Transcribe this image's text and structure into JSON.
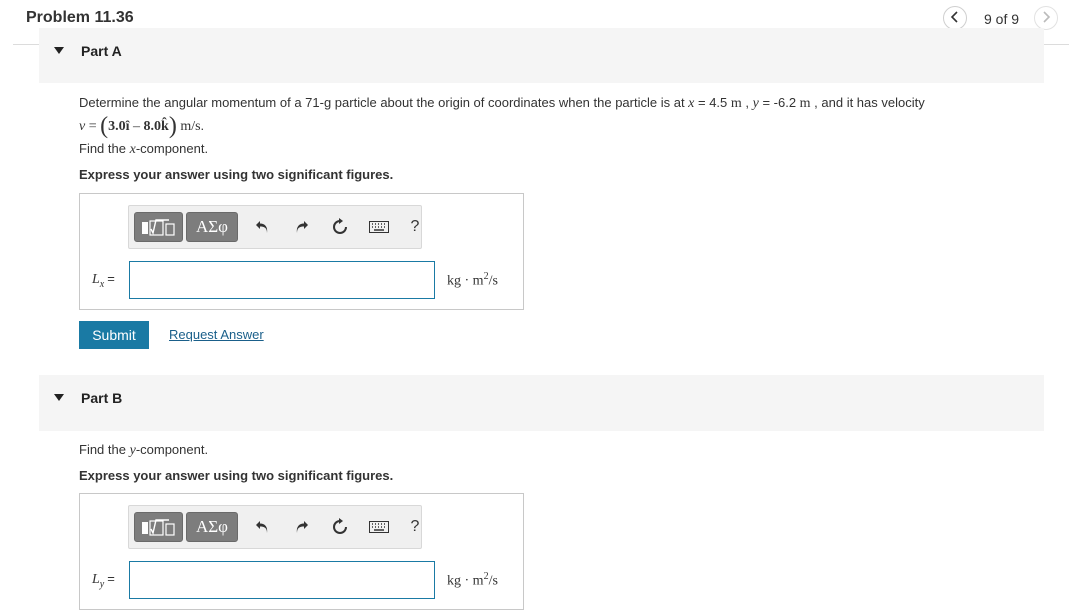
{
  "header": {
    "title": "Problem 11.36",
    "page_indicator": "9 of 9",
    "prev_icon": "chevron-left-icon",
    "next_icon": "chevron-right-icon"
  },
  "part_a": {
    "label": "Part A",
    "question_prefix": "Determine the angular momentum of a 71-g particle about the origin of coordinates when the particle is at ",
    "x_var": "x",
    "x_eq": " = 4.5 ",
    "x_unit": "m",
    "sep": " , ",
    "y_var": "y",
    "y_eq": " = -6.2 ",
    "y_unit": "m",
    "question_suffix": " , and it has velocity",
    "velocity_lhs": "v",
    "velocity_eq": " = ",
    "velocity_open": "(",
    "velocity_i": "3.0î",
    "velocity_minus": " – ",
    "velocity_k": "8.0k̂",
    "velocity_close": ")",
    "velocity_unit": " m/s",
    "velocity_period": ".",
    "find_prefix": "Find the ",
    "find_var": "x",
    "find_suffix": "-component.",
    "instruction": "Express your answer using two significant figures.",
    "answer_label_var": "L",
    "answer_label_sub": "x",
    "answer_label_eq": "=",
    "answer_value": "",
    "unit_base": "kg · m",
    "unit_exp": "2",
    "unit_tail": "/s",
    "submit_label": "Submit",
    "request_label": "Request Answer"
  },
  "part_b": {
    "label": "Part B",
    "find_prefix": "Find the ",
    "find_var": "y",
    "find_suffix": "-component.",
    "instruction": "Express your answer using two significant figures.",
    "answer_label_var": "L",
    "answer_label_sub": "y",
    "answer_label_eq": "=",
    "answer_value": "",
    "unit_base": "kg · m",
    "unit_exp": "2",
    "unit_tail": "/s"
  },
  "toolbar": {
    "greek_label": "ΑΣφ",
    "help_label": "?",
    "template_icon": "templates-icon",
    "undo_icon": "undo-icon",
    "redo_icon": "redo-icon",
    "reset_icon": "reset-icon",
    "keyboard_icon": "keyboard-icon"
  }
}
